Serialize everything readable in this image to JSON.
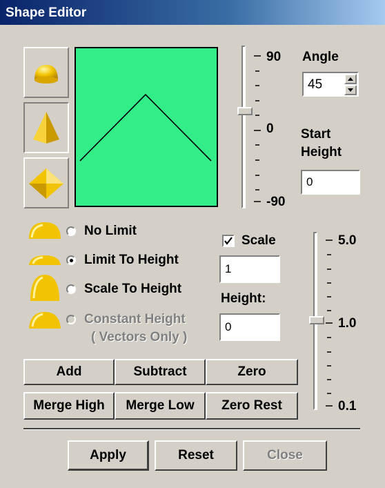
{
  "window": {
    "title": "Shape Editor"
  },
  "shape_buttons": [
    {
      "icon": "dome-shape-icon"
    },
    {
      "icon": "pyramid-shape-icon"
    },
    {
      "icon": "diamond-shape-icon"
    }
  ],
  "preview": {
    "background": "#33ee88",
    "line_color": "#000000"
  },
  "angle_slider": {
    "max_label": "90",
    "mid_label": "0",
    "min_label": "-90",
    "value": 45
  },
  "angle": {
    "label": "Angle",
    "value": "45"
  },
  "start_height": {
    "label_line1": "Start",
    "label_line2": "Height",
    "value": "0"
  },
  "limit_options": [
    {
      "label": "No Limit",
      "selected": false,
      "enabled": true
    },
    {
      "label": "Limit To Height",
      "selected": true,
      "enabled": true
    },
    {
      "label": "Scale To Height",
      "selected": false,
      "enabled": true
    },
    {
      "label": "Constant Height",
      "sub_label": "( Vectors Only )",
      "selected": false,
      "enabled": false
    }
  ],
  "scale": {
    "label": "Scale",
    "checked": true,
    "value": "1"
  },
  "height": {
    "label": "Height:",
    "value": "0"
  },
  "scale_slider": {
    "max_label": "5.0",
    "mid_label": "1.0",
    "min_label": "0.1",
    "value": 1.0
  },
  "ops": {
    "add": "Add",
    "subtract": "Subtract",
    "zero": "Zero",
    "merge_high": "Merge High",
    "merge_low": "Merge Low",
    "zero_rest": "Zero Rest"
  },
  "actions": {
    "apply": "Apply",
    "reset": "Reset",
    "close": "Close"
  },
  "colors": {
    "accent_yellow": "#f0c000",
    "title_blue": "#0a246a"
  }
}
